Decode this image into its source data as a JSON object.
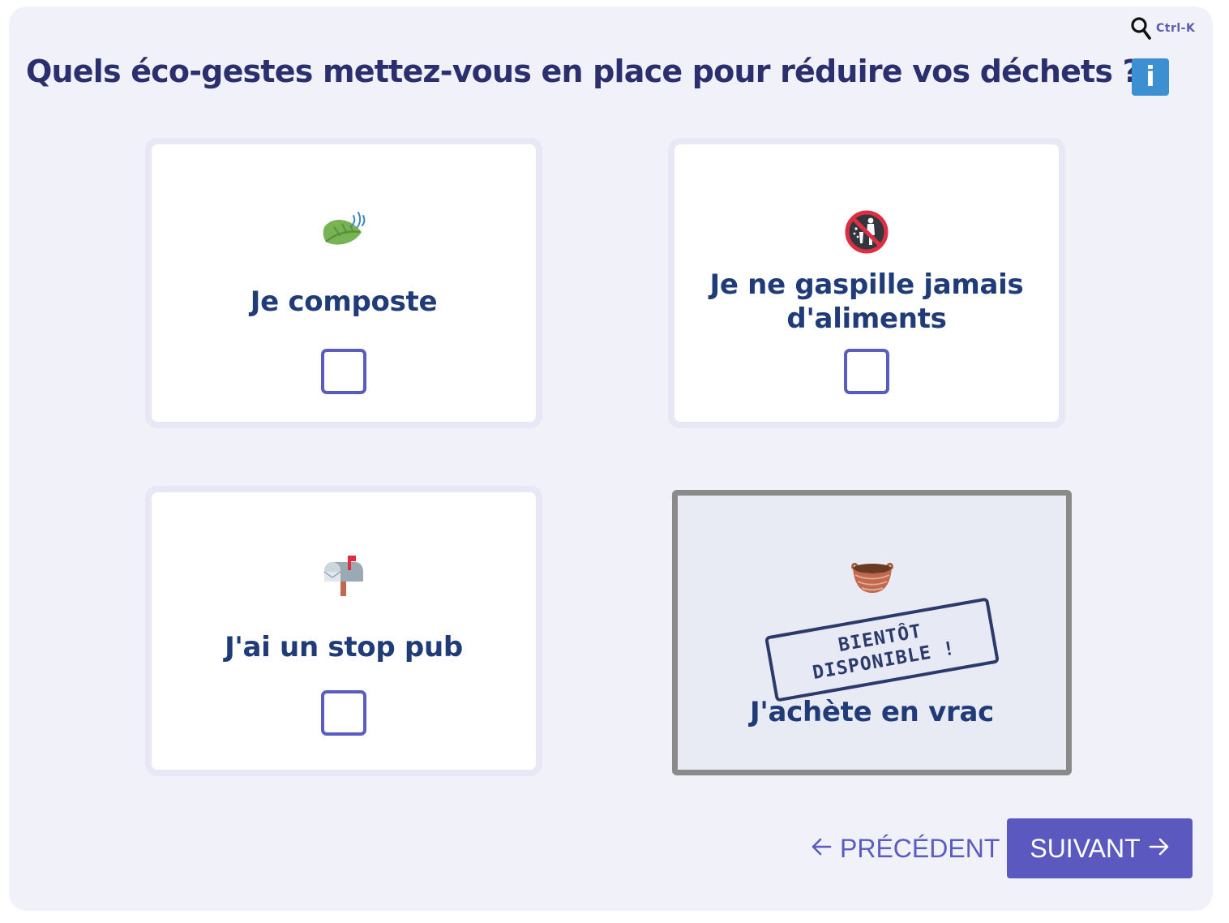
{
  "header": {
    "search_shortcut": "Ctrl-K",
    "question": "Quels éco-gestes mettez-vous en place pour réduire vos déchets ?",
    "info_label": "i"
  },
  "options": [
    {
      "label": "Je composte",
      "icon": "leaf-fluttering-icon",
      "checked": false
    },
    {
      "label_line1": "Je ne gaspille jamais",
      "label_line2": "d'aliments",
      "icon": "no-littering-icon",
      "checked": false
    },
    {
      "label": "J'ai un stop pub",
      "icon": "mailbox-icon",
      "checked": false
    },
    {
      "label": "J'achète en vrac",
      "icon": "basket-icon",
      "disabled": true,
      "stamp_line1": "BIENTÔT",
      "stamp_line2": "DISPONIBLE !"
    }
  ],
  "navigation": {
    "previous_label": "PRÉCÉDENT",
    "next_label": "SUIVANT"
  },
  "colors": {
    "panel_bg": "#f0f1f9",
    "title": "#2b2f6e",
    "label": "#1f3b78",
    "accent": "#5b58bf",
    "info": "#3c8fd0"
  }
}
